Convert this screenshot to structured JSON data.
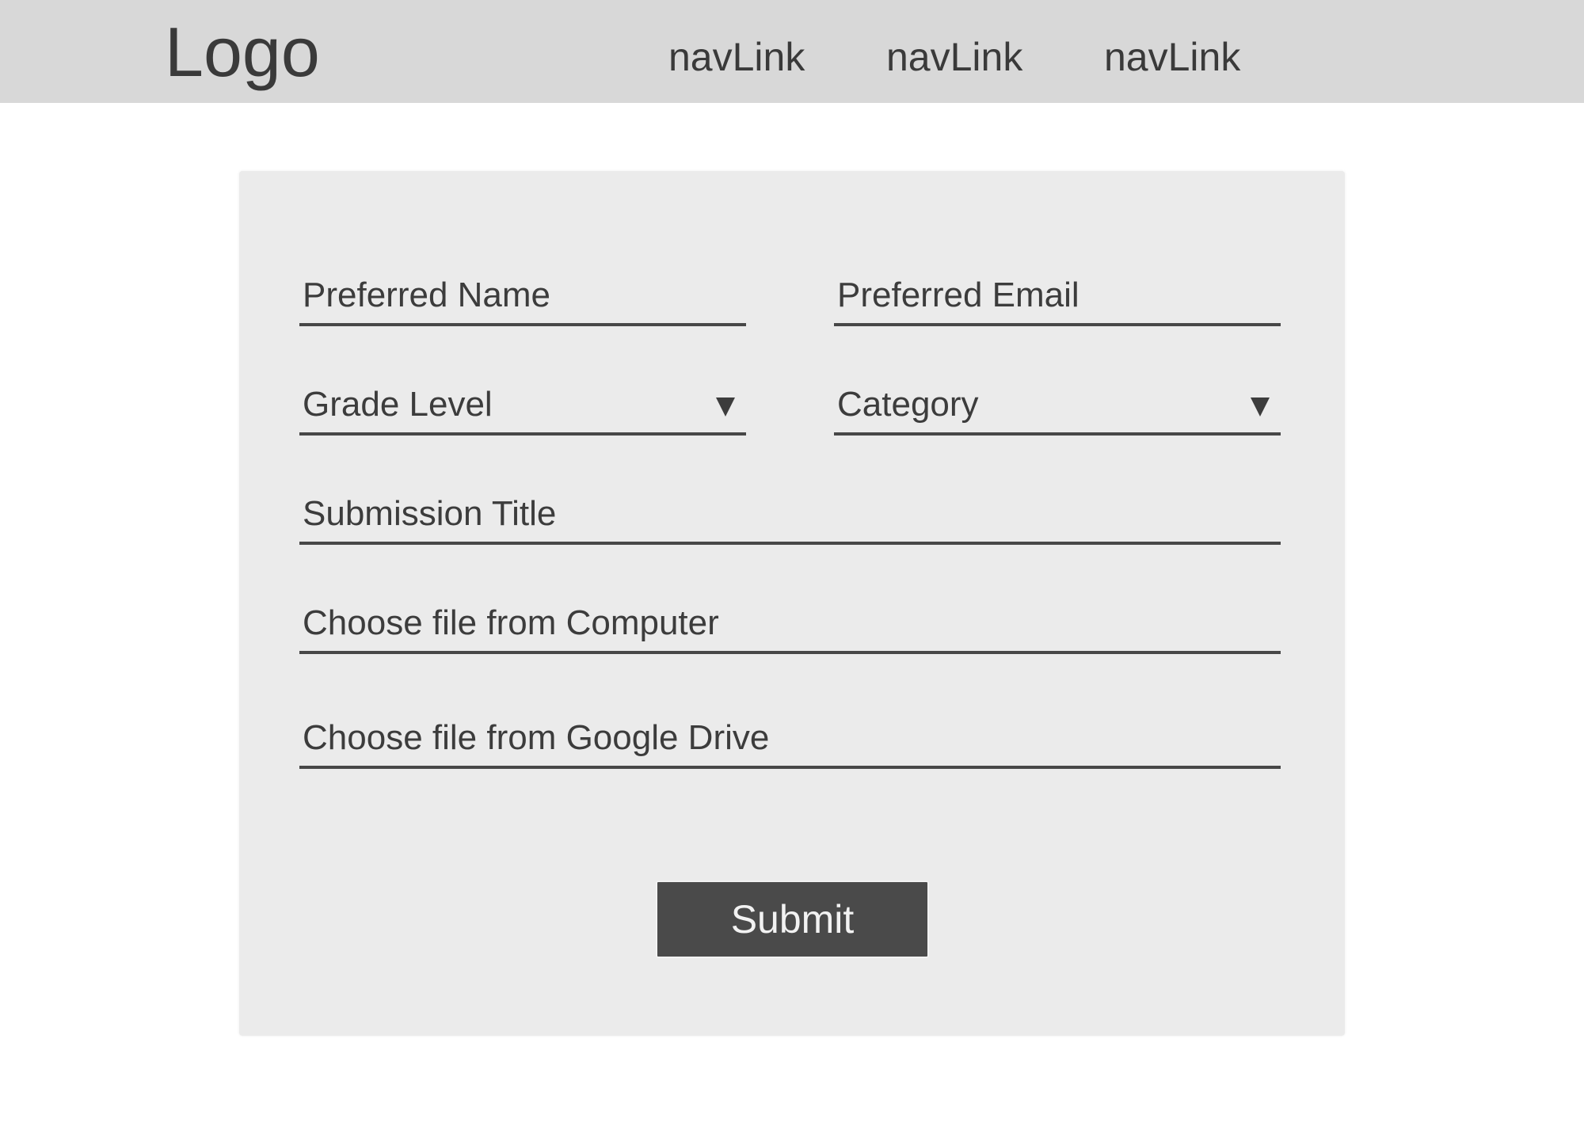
{
  "header": {
    "logo": "Logo",
    "nav_links": [
      "navLink",
      "navLink",
      "navLink"
    ]
  },
  "form": {
    "preferred_name": {
      "placeholder": "Preferred Name"
    },
    "preferred_email": {
      "placeholder": "Preferred Email"
    },
    "grade_level": {
      "placeholder": "Grade Level"
    },
    "category": {
      "placeholder": "Category"
    },
    "submission_title": {
      "placeholder": "Submission Title"
    },
    "file_computer": {
      "label": "Choose file from Computer"
    },
    "file_drive": {
      "label": "Choose file from Google Drive"
    },
    "submit_label": "Submit"
  },
  "colors": {
    "header_bg": "#d8d8d8",
    "card_bg": "#ebebeb",
    "text": "#3c3c3c",
    "button_bg": "#4a4a4a",
    "button_text": "#f2f2f2"
  }
}
